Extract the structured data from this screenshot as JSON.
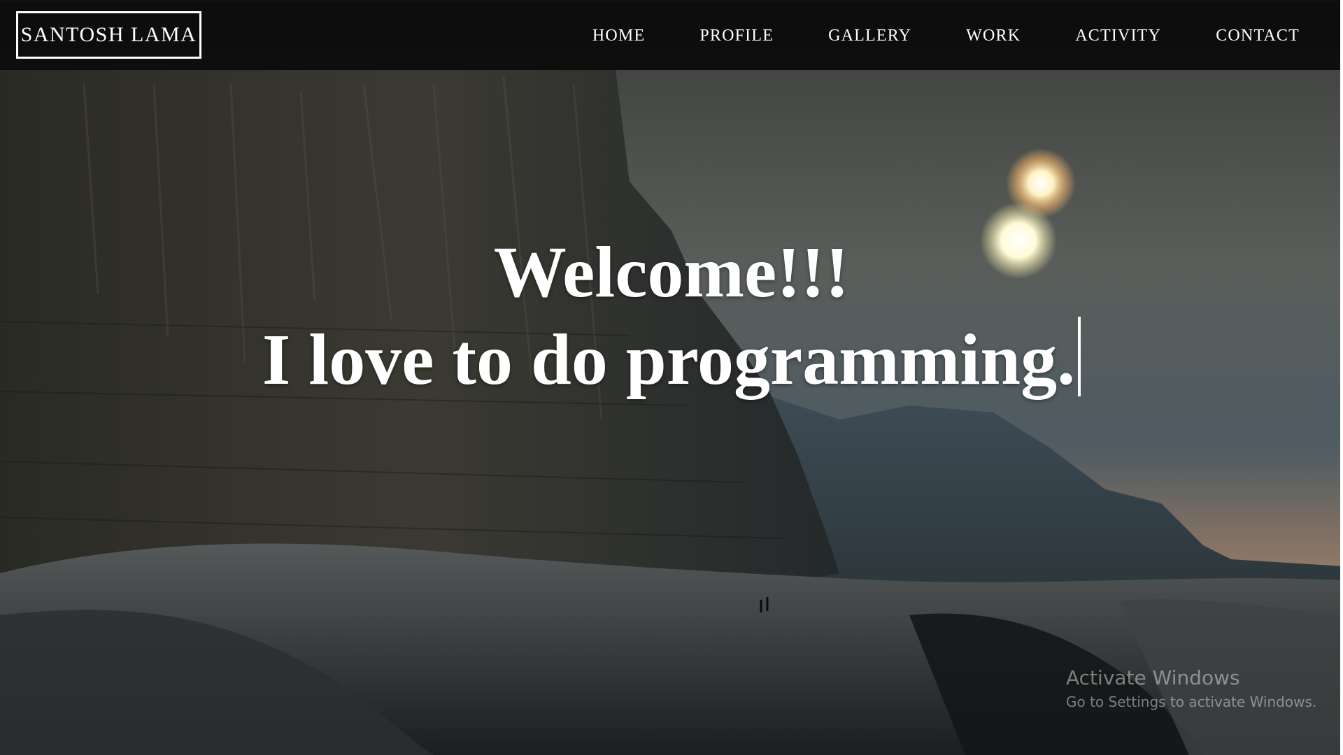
{
  "navbar": {
    "brand": "SANTOSH LAMA",
    "items": [
      "HOME",
      "PROFILE",
      "GALLERY",
      "WORK",
      "ACTIVITY",
      "CONTACT"
    ]
  },
  "hero": {
    "line1": "Welcome!!!",
    "line2": "I love to do programming."
  },
  "watermark": {
    "title": "Activate Windows",
    "subtitle": "Go to Settings to activate Windows."
  },
  "colors": {
    "navbar_bg": "#0a0a0a",
    "text": "#ffffff",
    "sky": "#5a5e5a",
    "sun": "#fff6c8"
  }
}
